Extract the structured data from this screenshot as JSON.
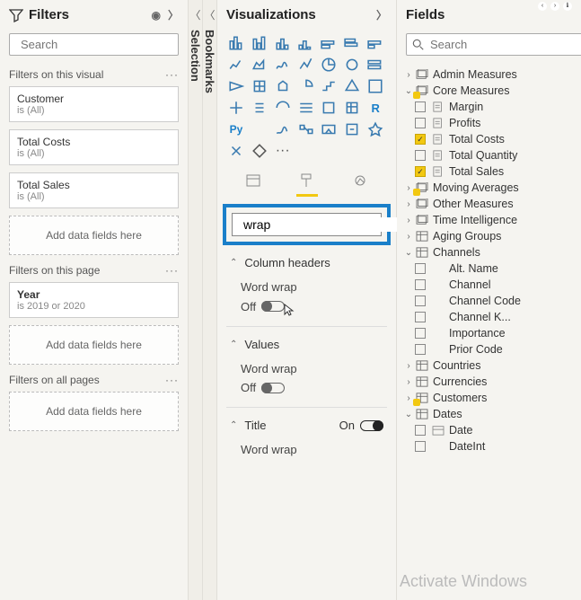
{
  "filters": {
    "title": "Filters",
    "search_placeholder": "Search",
    "sections": {
      "visual": {
        "label": "Filters on this visual",
        "cards": [
          {
            "name": "Customer",
            "summary": "is (All)"
          },
          {
            "name": "Total Costs",
            "summary": "is (All)"
          },
          {
            "name": "Total Sales",
            "summary": "is (All)"
          }
        ],
        "add_label": "Add data fields here"
      },
      "page": {
        "label": "Filters on this page",
        "cards": [
          {
            "name": "Year",
            "summary": "is 2019 or 2020"
          }
        ],
        "add_label": "Add data fields here"
      },
      "all": {
        "label": "Filters on all pages",
        "add_label": "Add data fields here"
      }
    }
  },
  "collapsed": {
    "selection": "Selection",
    "bookmarks": "Bookmarks"
  },
  "viz": {
    "title": "Visualizations",
    "search_value": "wrap",
    "more": "···",
    "py_label": "Py",
    "r_label": "R",
    "groups": {
      "column_headers": {
        "label": "Column headers",
        "word_wrap_label": "Word wrap",
        "word_wrap_state": "Off"
      },
      "values": {
        "label": "Values",
        "word_wrap_label": "Word wrap",
        "word_wrap_state": "Off"
      },
      "title": {
        "label": "Title",
        "state": "On",
        "word_wrap_label": "Word wrap"
      }
    }
  },
  "fields": {
    "title": "Fields",
    "search_placeholder": "Search",
    "tree": [
      {
        "type": "group",
        "exp": ">",
        "icon": "measure-group",
        "label": "Admin Measures"
      },
      {
        "type": "group",
        "exp": "v",
        "icon": "measure-group",
        "label": "Core Measures",
        "marked": true,
        "children": [
          {
            "checked": false,
            "icon": "measure",
            "label": "Margin"
          },
          {
            "checked": false,
            "icon": "measure",
            "label": "Profits"
          },
          {
            "checked": true,
            "icon": "measure",
            "label": "Total Costs"
          },
          {
            "checked": false,
            "icon": "measure",
            "label": "Total Quantity"
          },
          {
            "checked": true,
            "icon": "measure",
            "label": "Total Sales"
          }
        ]
      },
      {
        "type": "group",
        "exp": ">",
        "icon": "measure-group",
        "label": "Moving Averages",
        "marked": true
      },
      {
        "type": "group",
        "exp": ">",
        "icon": "measure-group",
        "label": "Other Measures"
      },
      {
        "type": "group",
        "exp": ">",
        "icon": "measure-group",
        "label": "Time Intelligence"
      },
      {
        "type": "group",
        "exp": ">",
        "icon": "table",
        "label": "Aging Groups"
      },
      {
        "type": "group",
        "exp": "v",
        "icon": "table",
        "label": "Channels",
        "children": [
          {
            "checked": false,
            "icon": "field",
            "label": "Alt. Name"
          },
          {
            "checked": false,
            "icon": "field",
            "label": "Channel"
          },
          {
            "checked": false,
            "icon": "field",
            "label": "Channel Code"
          },
          {
            "checked": false,
            "icon": "field",
            "label": "Channel K...",
            "hidden": true
          },
          {
            "checked": false,
            "icon": "field",
            "label": "Importance"
          },
          {
            "checked": false,
            "icon": "field",
            "label": "Prior Code"
          }
        ]
      },
      {
        "type": "group",
        "exp": ">",
        "icon": "table",
        "label": "Countries"
      },
      {
        "type": "group",
        "exp": ">",
        "icon": "table",
        "label": "Currencies"
      },
      {
        "type": "group",
        "exp": ">",
        "icon": "table",
        "label": "Customers",
        "marked": true
      },
      {
        "type": "group",
        "exp": "v",
        "icon": "table",
        "label": "Dates",
        "children": [
          {
            "checked": false,
            "icon": "date",
            "label": "Date"
          },
          {
            "checked": false,
            "icon": "field",
            "label": "DateInt"
          }
        ]
      }
    ]
  },
  "watermark": "Activate Windows"
}
